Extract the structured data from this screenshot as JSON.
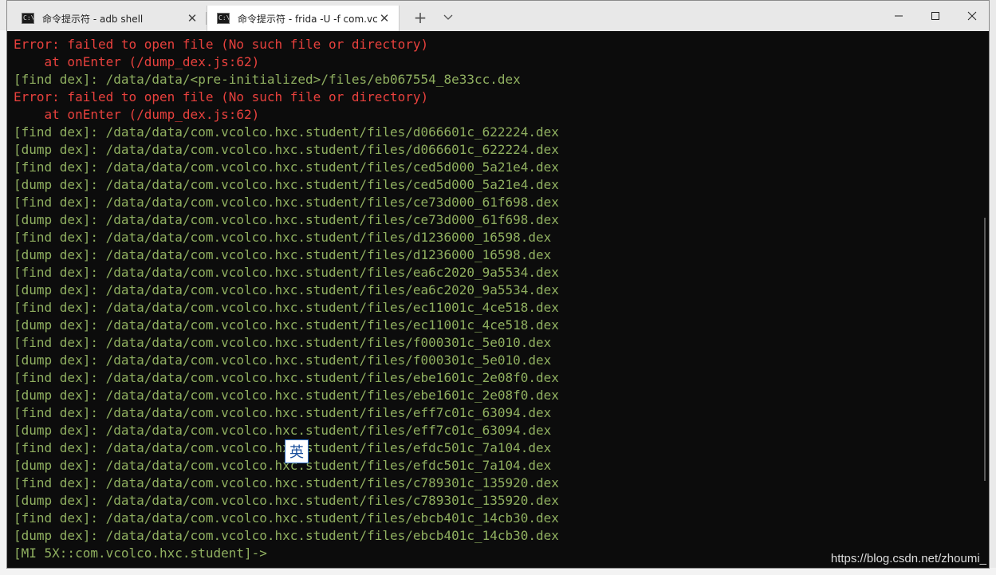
{
  "tabs": [
    {
      "title": "命令提示符 - adb  shell",
      "icon_text": "C:\\",
      "active": false
    },
    {
      "title": "命令提示符 - frida  -U -f com.vc",
      "icon_text": "C:\\",
      "active": true
    }
  ],
  "tab_controls": {
    "new_tab_icon": "plus-icon",
    "dropdown_icon": "chevron-down-icon"
  },
  "window_controls": {
    "minimize_icon": "minimize-icon",
    "maximize_icon": "maximize-icon",
    "close_icon": "close-icon"
  },
  "colors": {
    "error": "#e8413d",
    "output": "#90b060",
    "background": "#0c0c0c"
  },
  "terminal": {
    "lines": [
      {
        "text": "Error: failed to open file (No such file or directory)",
        "kind": "error"
      },
      {
        "text": "    at onEnter (/dump_dex.js:62)",
        "kind": "error"
      },
      {
        "text": "[find dex]: /data/data/<pre-initialized>/files/eb067554_8e33cc.dex",
        "kind": "output"
      },
      {
        "text": "Error: failed to open file (No such file or directory)",
        "kind": "error"
      },
      {
        "text": "    at onEnter (/dump_dex.js:62)",
        "kind": "error"
      },
      {
        "text": "[find dex]: /data/data/com.vcolco.hxc.student/files/d066601c_622224.dex",
        "kind": "output"
      },
      {
        "text": "[dump dex]: /data/data/com.vcolco.hxc.student/files/d066601c_622224.dex",
        "kind": "output"
      },
      {
        "text": "[find dex]: /data/data/com.vcolco.hxc.student/files/ced5d000_5a21e4.dex",
        "kind": "output"
      },
      {
        "text": "[dump dex]: /data/data/com.vcolco.hxc.student/files/ced5d000_5a21e4.dex",
        "kind": "output"
      },
      {
        "text": "[find dex]: /data/data/com.vcolco.hxc.student/files/ce73d000_61f698.dex",
        "kind": "output"
      },
      {
        "text": "[dump dex]: /data/data/com.vcolco.hxc.student/files/ce73d000_61f698.dex",
        "kind": "output"
      },
      {
        "text": "[find dex]: /data/data/com.vcolco.hxc.student/files/d1236000_16598.dex",
        "kind": "output"
      },
      {
        "text": "[dump dex]: /data/data/com.vcolco.hxc.student/files/d1236000_16598.dex",
        "kind": "output"
      },
      {
        "text": "[find dex]: /data/data/com.vcolco.hxc.student/files/ea6c2020_9a5534.dex",
        "kind": "output"
      },
      {
        "text": "[dump dex]: /data/data/com.vcolco.hxc.student/files/ea6c2020_9a5534.dex",
        "kind": "output"
      },
      {
        "text": "[find dex]: /data/data/com.vcolco.hxc.student/files/ec11001c_4ce518.dex",
        "kind": "output"
      },
      {
        "text": "[dump dex]: /data/data/com.vcolco.hxc.student/files/ec11001c_4ce518.dex",
        "kind": "output"
      },
      {
        "text": "[find dex]: /data/data/com.vcolco.hxc.student/files/f000301c_5e010.dex",
        "kind": "output"
      },
      {
        "text": "[dump dex]: /data/data/com.vcolco.hxc.student/files/f000301c_5e010.dex",
        "kind": "output"
      },
      {
        "text": "[find dex]: /data/data/com.vcolco.hxc.student/files/ebe1601c_2e08f0.dex",
        "kind": "output"
      },
      {
        "text": "[dump dex]: /data/data/com.vcolco.hxc.student/files/ebe1601c_2e08f0.dex",
        "kind": "output"
      },
      {
        "text": "[find dex]: /data/data/com.vcolco.hxc.student/files/eff7c01c_63094.dex",
        "kind": "output"
      },
      {
        "text": "[dump dex]: /data/data/com.vcolco.hxc.student/files/eff7c01c_63094.dex",
        "kind": "output"
      },
      {
        "text": "[find dex]: /data/data/com.vcolco.hxc.student/files/efdc501c_7a104.dex",
        "kind": "output"
      },
      {
        "text": "[dump dex]: /data/data/com.vcolco.hxc.student/files/efdc501c_7a104.dex",
        "kind": "output"
      },
      {
        "text": "[find dex]: /data/data/com.vcolco.hxc.student/files/c789301c_135920.dex",
        "kind": "output"
      },
      {
        "text": "[dump dex]: /data/data/com.vcolco.hxc.student/files/c789301c_135920.dex",
        "kind": "output"
      },
      {
        "text": "[find dex]: /data/data/com.vcolco.hxc.student/files/ebcb401c_14cb30.dex",
        "kind": "output"
      },
      {
        "text": "[dump dex]: /data/data/com.vcolco.hxc.student/files/ebcb401c_14cb30.dex",
        "kind": "output"
      },
      {
        "text": "[MI 5X::com.vcolco.hxc.student]->",
        "kind": "prompt"
      }
    ]
  },
  "ime": {
    "label": "英"
  },
  "watermark": "https://blog.csdn.net/zhoumi_"
}
